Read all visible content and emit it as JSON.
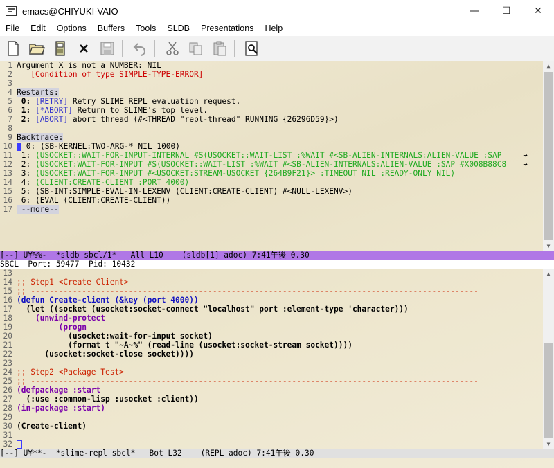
{
  "window": {
    "title": "emacs@CHIYUKI-VAIO",
    "minimize": "—",
    "maximize": "☐",
    "close": "✕"
  },
  "menu": [
    "File",
    "Edit",
    "Options",
    "Buffers",
    "Tools",
    "SLDB",
    "Presentations",
    "Help"
  ],
  "toolbar_icons": [
    "new-file-icon",
    "open-folder-icon",
    "save-disk-icon",
    "close-x-icon",
    "save-icon",
    "undo-icon",
    "cut-icon",
    "copy-icon",
    "paste-icon",
    "search-icon"
  ],
  "sldb": {
    "lines": [
      {
        "n": "1",
        "text": "Argument X is not a NUMBER: NIL"
      },
      {
        "n": "2",
        "text": "   [Condition of type SIMPLE-TYPE-ERROR]"
      },
      {
        "n": "3",
        "text": ""
      },
      {
        "n": "4",
        "text": "Restarts:"
      },
      {
        "n": "5",
        "pre": " 0: ",
        "tag": "[RETRY]",
        "text": " Retry SLIME REPL evaluation request."
      },
      {
        "n": "6",
        "pre": " 1: ",
        "tag": "[*ABORT]",
        "text": " Return to SLIME's top level."
      },
      {
        "n": "7",
        "pre": " 2: ",
        "tag": "[ABORT]",
        "text": " abort thread (#<THREAD \"repl-thread\" RUNNING {26296D59}>)"
      },
      {
        "n": "8",
        "text": ""
      },
      {
        "n": "9",
        "text": "Backtrace:"
      },
      {
        "n": "10",
        "pre": " 0: ",
        "text": "(SB-KERNEL:TWO-ARG-* NIL 1000)"
      },
      {
        "n": "11",
        "pre": " 1: ",
        "text": "(USOCKET::WAIT-FOR-INPUT-INTERNAL #S(USOCKET::WAIT-LIST :%WAIT #<SB-ALIEN-INTERNALS:ALIEN-VALUE :SAP"
      },
      {
        "n": "12",
        "pre": " 2: ",
        "text": "(USOCKET:WAIT-FOR-INPUT #S(USOCKET::WAIT-LIST :%WAIT #<SB-ALIEN-INTERNALS:ALIEN-VALUE :SAP #X008B88C8"
      },
      {
        "n": "13",
        "pre": " 3: ",
        "text": "(USOCKET:WAIT-FOR-INPUT #<USOCKET:STREAM-USOCKET {264B9F21}> :TIMEOUT NIL :READY-ONLY NIL)"
      },
      {
        "n": "14",
        "pre": " 4: ",
        "text": "(CLIENT:CREATE-CLIENT :PORT 4000)"
      },
      {
        "n": "15",
        "pre": " 5: ",
        "text": "(SB-INT:SIMPLE-EVAL-IN-LEXENV (CLIENT:CREATE-CLIENT) #<NULL-LEXENV>)"
      },
      {
        "n": "16",
        "pre": " 6: ",
        "text": "(EVAL (CLIENT:CREATE-CLIENT))"
      },
      {
        "n": "17",
        "text": " --more--"
      }
    ],
    "modeline": "[--] U¥%%-  *sldb sbcl/1*   All L10    (sldb[1] adoc) 7:41午後 0.30",
    "overflow_arrow": "➔"
  },
  "sbcl_status": "SBCL  Port: 59477  Pid: 10432",
  "repl": {
    "lines": [
      {
        "n": "13",
        "text": ""
      },
      {
        "n": "14",
        "text": ";; Step1 <Create Client>"
      },
      {
        "n": "15",
        "text": ";; ------------------------------------------------------------------------------------------------"
      },
      {
        "n": "16",
        "text": "(defun Create-client (&key (port 4000))"
      },
      {
        "n": "17",
        "text": "  (let ((socket (usocket:socket-connect \"localhost\" port :element-type 'character)))"
      },
      {
        "n": "18",
        "text": "    (unwind-protect"
      },
      {
        "n": "19",
        "text": "         (progn"
      },
      {
        "n": "20",
        "text": "           (usocket:wait-for-input socket)"
      },
      {
        "n": "21",
        "text": "           (format t \"~A~%\" (read-line (usocket:socket-stream socket))))"
      },
      {
        "n": "22",
        "text": "      (usocket:socket-close socket))))"
      },
      {
        "n": "23",
        "text": ""
      },
      {
        "n": "24",
        "text": ";; Step2 <Package Test>"
      },
      {
        "n": "25",
        "text": ";; ------------------------------------------------------------------------------------------------"
      },
      {
        "n": "26",
        "text": "(defpackage :start"
      },
      {
        "n": "27",
        "text": "  (:use :common-lisp :usocket :client))"
      },
      {
        "n": "28",
        "text": "(in-package :start)"
      },
      {
        "n": "29",
        "text": ""
      },
      {
        "n": "30",
        "text": "(Create-client)"
      },
      {
        "n": "31",
        "text": ""
      },
      {
        "n": "32",
        "text": ""
      }
    ],
    "modeline": "[--] U¥**-  *slime-repl sbcl*   Bot L32    (REPL adoc) 7:41午後 0.30"
  }
}
